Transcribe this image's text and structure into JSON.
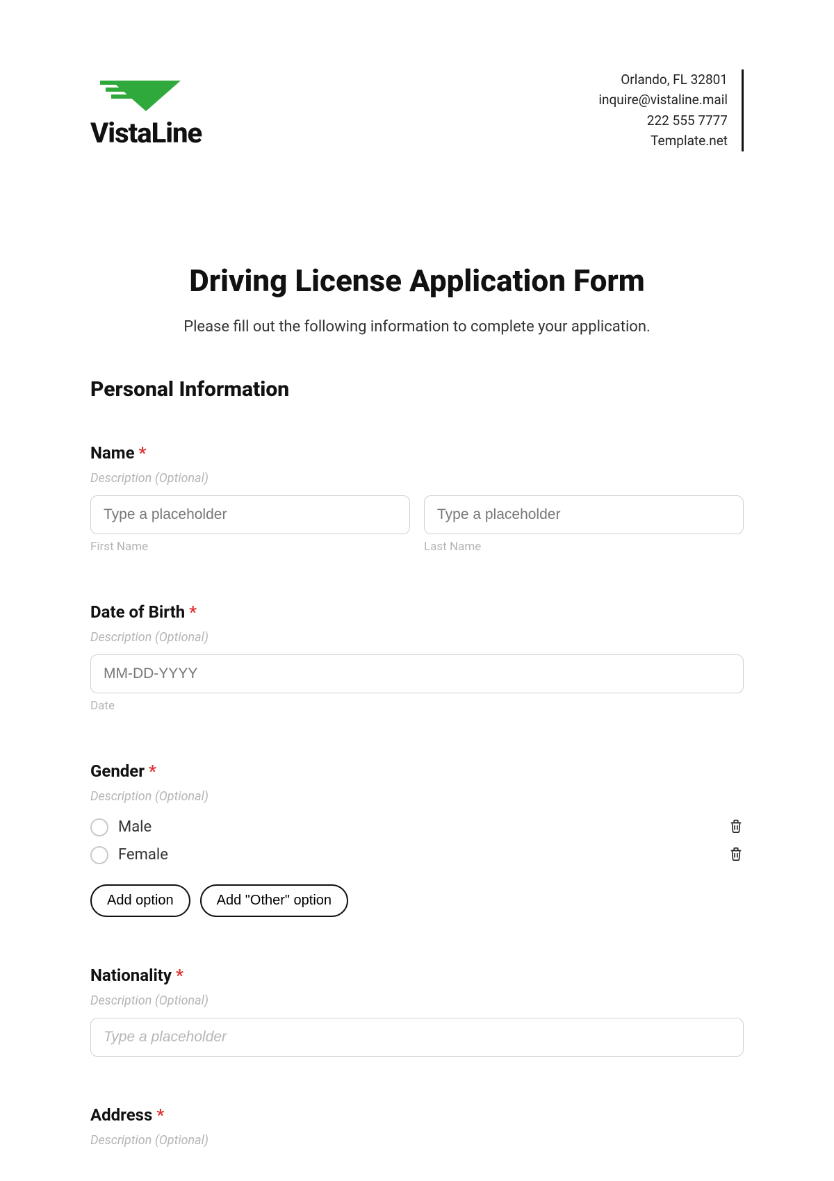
{
  "header": {
    "brand": "VistaLine",
    "contact": {
      "line1": "Orlando, FL 32801",
      "line2": "inquire@vistaline.mail",
      "line3": "222 555 7777",
      "line4": "Template.net"
    }
  },
  "form": {
    "title": "Driving License Application Form",
    "subtitle": "Please fill out the following information to complete your application.",
    "section1_title": "Personal Information",
    "name": {
      "label": "Name",
      "required_mark": "*",
      "description": "Description (Optional)",
      "first_placeholder": "Type a placeholder",
      "last_placeholder": "Type a placeholder",
      "first_sublabel": "First Name",
      "last_sublabel": "Last Name"
    },
    "dob": {
      "label": "Date of Birth",
      "required_mark": "*",
      "description": "Description (Optional)",
      "placeholder": "MM-DD-YYYY",
      "sublabel": "Date"
    },
    "gender": {
      "label": "Gender",
      "required_mark": "*",
      "description": "Description (Optional)",
      "options": {
        "o1": "Male",
        "o2": "Female"
      },
      "add_option": "Add option",
      "add_other": "Add \"Other\" option"
    },
    "nationality": {
      "label": "Nationality",
      "required_mark": "*",
      "description": "Description (Optional)",
      "placeholder": "Type a placeholder"
    },
    "address": {
      "label": "Address",
      "required_mark": "*",
      "description": "Description (Optional)"
    }
  }
}
